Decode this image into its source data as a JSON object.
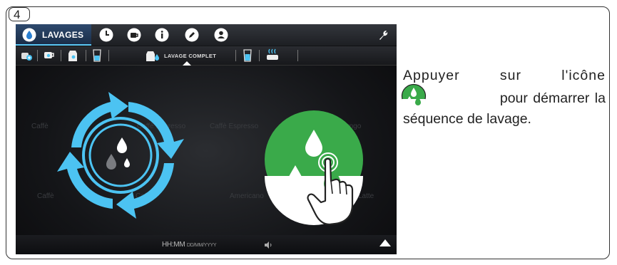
{
  "step": {
    "number": "4"
  },
  "screen": {
    "topbar": {
      "active_tab": "LAVAGES",
      "icons": [
        "water-drop-icon",
        "clock-icon",
        "cup-icon",
        "info-icon",
        "pencil-icon",
        "user-icon",
        "wrench-icon"
      ]
    },
    "subbar": {
      "active_label": "LAVAGE COMPLET",
      "icons": [
        "cup-rinse-icon",
        "cup-icon",
        "milk-carafe-icon",
        "glass-icon",
        "complete-wash-icon",
        "glass-drop-icon",
        "steam-icon"
      ]
    },
    "background_labels": [
      "Caffè",
      "Caffè Espresso",
      "Caffè Espresso",
      "Caffè Lungo",
      "Caffè",
      "Caffè",
      "Americano",
      "Latte"
    ],
    "bottombar": {
      "time": "HH:MM",
      "date": "DD/MM/YYYY"
    }
  },
  "instructions": {
    "line1_word1": "Appuyer",
    "line1_word2": "sur",
    "line1_word3": "l'icône",
    "line2_text": "pour démarrer la",
    "line3_text": "séquence de lavage."
  },
  "colors": {
    "accent_blue": "#4cc3f2",
    "wash_green": "#3aaa4a"
  }
}
